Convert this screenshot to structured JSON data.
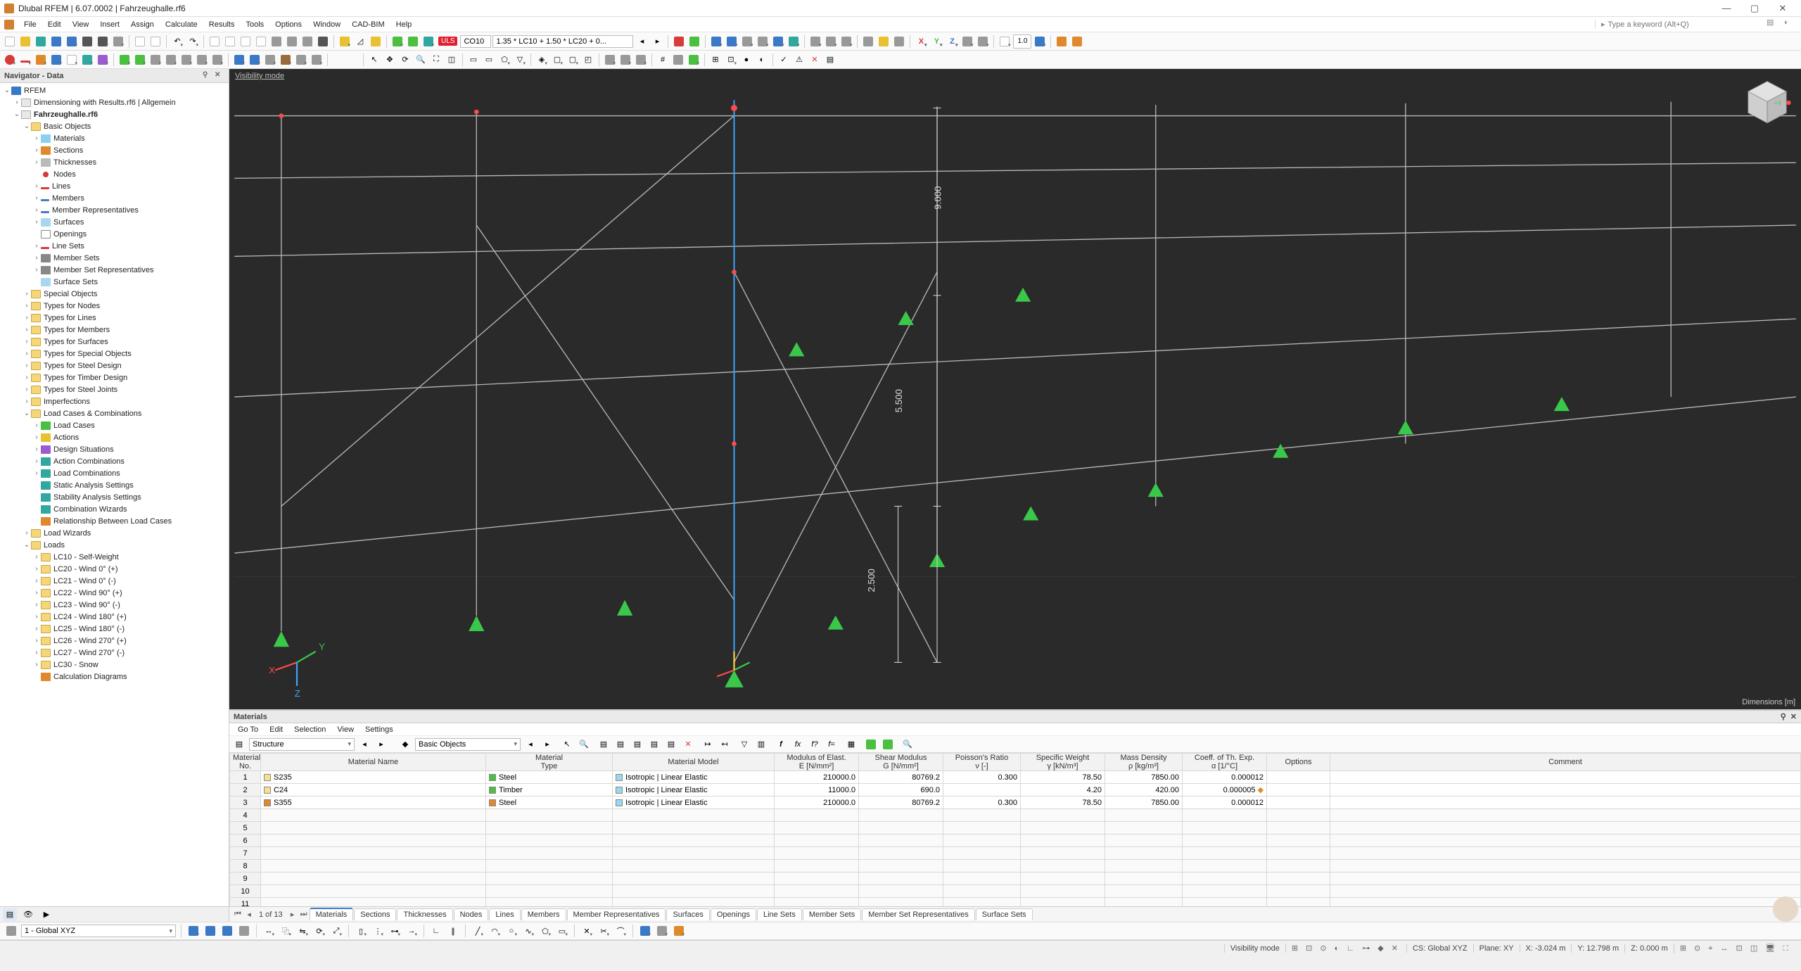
{
  "app": {
    "title": "Dlubal RFEM | 6.07.0002 | Fahrzeughalle.rf6"
  },
  "menu": [
    "File",
    "Edit",
    "View",
    "Insert",
    "Assign",
    "Calculate",
    "Results",
    "Tools",
    "Options",
    "Window",
    "CAD-BIM",
    "Help"
  ],
  "search_placeholder": "Type a keyword (Alt+Q)",
  "toolbar1": {
    "uls": "ULS",
    "combo": "CO10",
    "combo_expr": "1.35 * LC10 + 1.50 * LC20 + 0..."
  },
  "navigator": {
    "title": "Navigator - Data",
    "root": "RFEM",
    "dim_file": "Dimensioning with Results.rf6 | Allgemein",
    "model_file": "Fahrzeughalle.rf6",
    "basic_objects": "Basic Objects",
    "basic_children": [
      "Materials",
      "Sections",
      "Thicknesses",
      "Nodes",
      "Lines",
      "Members",
      "Member Representatives",
      "Surfaces",
      "Openings",
      "Line Sets",
      "Member Sets",
      "Member Set Representatives",
      "Surface Sets"
    ],
    "mid_folders": [
      "Special Objects",
      "Types for Nodes",
      "Types for Lines",
      "Types for Members",
      "Types for Surfaces",
      "Types for Special Objects",
      "Types for Steel Design",
      "Types for Timber Design",
      "Types for Steel Joints",
      "Imperfections"
    ],
    "lcc": "Load Cases & Combinations",
    "lcc_children": [
      "Load Cases",
      "Actions",
      "Design Situations",
      "Action Combinations",
      "Load Combinations",
      "Static Analysis Settings",
      "Stability Analysis Settings",
      "Combination Wizards",
      "Relationship Between Load Cases"
    ],
    "load_wizards": "Load Wizards",
    "loads": "Loads",
    "load_children": [
      "LC10 - Self-Weight",
      "LC20 - Wind 0° (+)",
      "LC21 - Wind 0° (-)",
      "LC22 - Wind 90° (+)",
      "LC23 - Wind 90° (-)",
      "LC24 - Wind 180° (+)",
      "LC25 - Wind 180° (-)",
      "LC26 - Wind 270° (+)",
      "LC27 - Wind 270° (-)",
      "LC30 - Snow"
    ],
    "calc_diag": "Calculation Diagrams"
  },
  "viewport": {
    "mode_label": "Visibility mode",
    "dim_unit": "Dimensions [m]",
    "dims": [
      "9.000",
      "5.500",
      "2.500"
    ]
  },
  "table": {
    "title": "Materials",
    "menu": [
      "Go To",
      "Edit",
      "Selection",
      "View",
      "Settings"
    ],
    "left_select": "Structure",
    "right_select": "Basic Objects",
    "headers": {
      "no": "Material\nNo.",
      "name": "Material Name",
      "type": "Material\nType",
      "model": "Material Model",
      "e": "Modulus of Elast.\nE [N/mm²]",
      "g": "Shear Modulus\nG [N/mm²]",
      "nu": "Poisson's Ratio\nν [-]",
      "gamma": "Specific Weight\nγ [kN/m³]",
      "rho": "Mass Density\nρ [kg/m³]",
      "alpha": "Coeff. of Th. Exp.\nα [1/°C]",
      "opt": "Options",
      "comment": "Comment"
    },
    "rows": [
      {
        "no": "1",
        "name": "S235",
        "name_color": "#f5e28a",
        "type": "Steel",
        "type_color": "#4abf40",
        "model": "Isotropic | Linear Elastic",
        "model_color": "#9ad8f0",
        "e": "210000.0",
        "g": "80769.2",
        "nu": "0.300",
        "gamma": "78.50",
        "rho": "7850.00",
        "alpha": "0.000012"
      },
      {
        "no": "2",
        "name": "C24",
        "name_color": "#f5e28a",
        "type": "Timber",
        "type_color": "#4abf40",
        "model": "Isotropic | Linear Elastic",
        "model_color": "#9ad8f0",
        "e": "11000.0",
        "g": "690.0",
        "nu": "",
        "gamma": "4.20",
        "rho": "420.00",
        "alpha": "0.000005",
        "alpha_flag": true
      },
      {
        "no": "3",
        "name": "S355",
        "name_color": "#e0892c",
        "type": "Steel",
        "type_color": "#e0892c",
        "model": "Isotropic | Linear Elastic",
        "model_color": "#9ad8f0",
        "e": "210000.0",
        "g": "80769.2",
        "nu": "0.300",
        "gamma": "78.50",
        "rho": "7850.00",
        "alpha": "0.000012"
      }
    ],
    "tabstrip": {
      "page": "1 of 13",
      "tabs": [
        "Materials",
        "Sections",
        "Thicknesses",
        "Nodes",
        "Lines",
        "Members",
        "Member Representatives",
        "Surfaces",
        "Openings",
        "Line Sets",
        "Member Sets",
        "Member Set Representatives",
        "Surface Sets"
      ]
    }
  },
  "ctx_select": "1 - Global XYZ",
  "statusbar": {
    "vis": "Visibility mode",
    "cs": "CS: Global XYZ",
    "plane": "Plane: XY",
    "x": "X: -3.024 m",
    "y": "Y: 12.798 m",
    "z": "Z: 0.000 m"
  }
}
